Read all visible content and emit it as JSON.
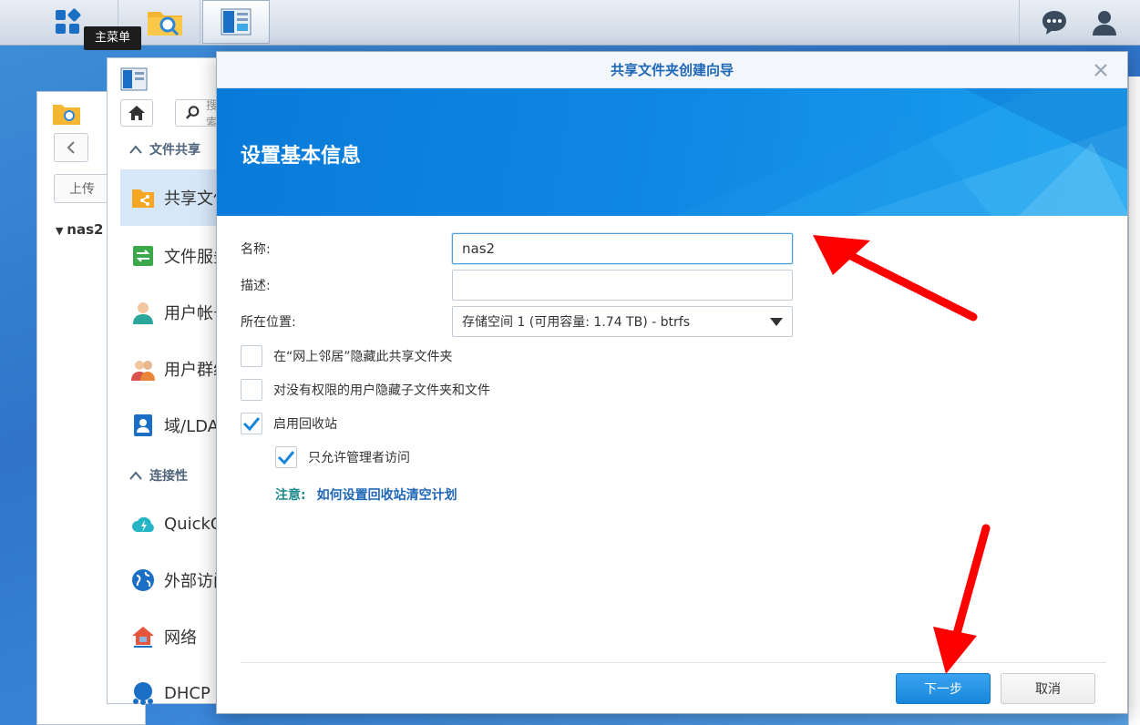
{
  "taskbar": {
    "tooltip": "主菜单"
  },
  "file_station": {
    "upload_label": "上传",
    "tree_node": "nas2"
  },
  "control_panel": {
    "search_placeholder": "搜索",
    "sections": [
      {
        "label": "文件共享"
      },
      {
        "label": "连接性"
      }
    ],
    "items": [
      {
        "label": "共享文件夹"
      },
      {
        "label": "文件服务"
      },
      {
        "label": "用户帐号"
      },
      {
        "label": "用户群组"
      },
      {
        "label": "域/LDAP"
      },
      {
        "label": "QuickConnect"
      },
      {
        "label": "外部访问"
      },
      {
        "label": "网络"
      },
      {
        "label": "DHCP Server"
      }
    ]
  },
  "dialog": {
    "title": "共享文件夹创建向导",
    "banner_title": "设置基本信息",
    "form": {
      "name_label": "名称:",
      "name_value": "nas2",
      "desc_label": "描述:",
      "desc_value": "",
      "location_label": "所在位置:",
      "location_value": "存储空间 1 (可用容量:  1.74 TB) - btrfs"
    },
    "checkboxes": [
      {
        "label": "在“网上邻居”隐藏此共享文件夹",
        "checked": false
      },
      {
        "label": "对没有权限的用户隐藏子文件夹和文件",
        "checked": false
      },
      {
        "label": "启用回收站",
        "checked": true
      },
      {
        "label": "只允许管理者访问",
        "checked": true
      }
    ],
    "note_label": "注意:",
    "note_link": "如何设置回收站清空计划",
    "next_label": "下一步",
    "cancel_label": "取消"
  },
  "colors": {
    "accent": "#1787db",
    "title_blue": "#1f67b6",
    "annotation_red": "#ff0000"
  }
}
